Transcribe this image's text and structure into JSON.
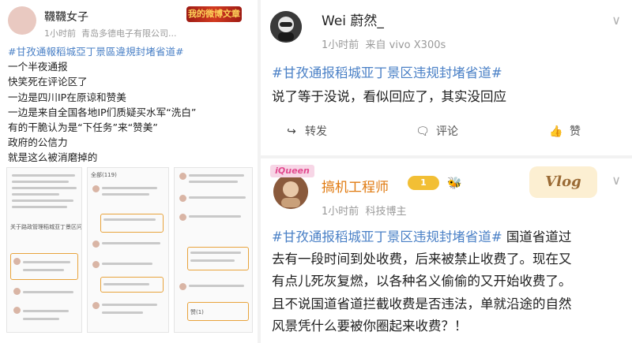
{
  "left_post": {
    "username": "韈韈女子",
    "badge_text": "我的微博文章",
    "time": "1小时前",
    "device": "青岛多德电子有限公司...",
    "topic": "#甘孜通報稻城亞丁景區違規封堵省道#",
    "lines": [
      "一个半夜通报",
      "快笑死在评论区了",
      "一边是四川IP在原谅和赞美",
      "一边是来自全国各地IP们质疑买水军“洗白”",
      "有的干脆认为是“下任务”来“赞美”",
      "政府的公信力",
      "就是这么被消磨掉的"
    ],
    "screenshot_texts": [
      "关于路政管理稻城亚丁景区问题的通报",
      "全部(119)",
      "赞(1)"
    ]
  },
  "right_top_post": {
    "username": "Wei 蔚然_",
    "time": "1小时前",
    "source": "来自 vivo X300s",
    "topic": "#甘孜通报稻城亚丁景区违规封堵省道#",
    "text": "说了等于没说，看似回应了，其实没回应",
    "actions": {
      "repost": "转发",
      "comment": "评论",
      "like": "赞"
    }
  },
  "right_bottom_post": {
    "avatar_tag": "iQueen",
    "username": "搞机工程师",
    "level": "1",
    "vlog_badge": "Vlog",
    "time": "1小时前",
    "source": "科技博主",
    "topic": "#甘孜通报稻城亚丁景区违规封堵省道#",
    "lines_rest": [
      "国道省道过",
      "去有一段时间到处收费，后来被禁止收费了。现在又",
      "有点儿死灰复燃，以各种名义偷偷的又开始收费了。",
      "且不说国道省道拦截收费是否违法，单就沿途的自然",
      "风景凭什么要被你圈起来收费？！"
    ]
  },
  "colors": {
    "topic": "#4a80c6",
    "username_highlight": "#e07a10",
    "meta": "#9a9a9a"
  },
  "icons": [
    "chevron-down-icon",
    "repost-icon",
    "comment-icon",
    "like-icon"
  ]
}
